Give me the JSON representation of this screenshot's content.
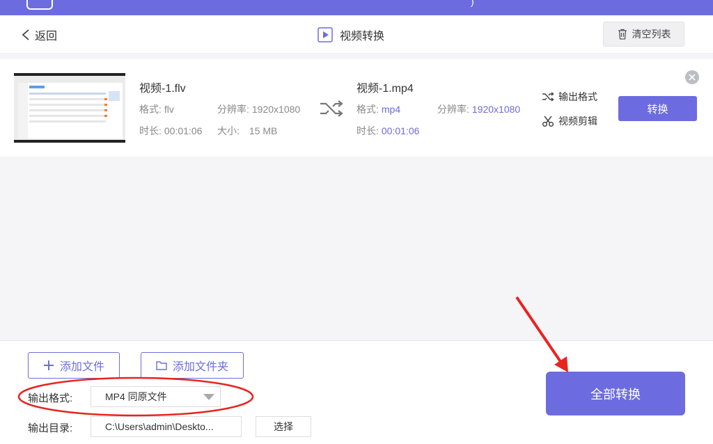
{
  "header": {
    "back_label": "返回",
    "title": "视频转换",
    "clear_label": "清空列表"
  },
  "file": {
    "source": {
      "name": "视频-1.flv",
      "format_label": "格式:",
      "format": "flv",
      "resolution_label": "分辨率:",
      "resolution": "1920x1080",
      "duration_label": "时长:",
      "duration": "00:01:06",
      "size_label": "大小:",
      "size": "15 MB"
    },
    "target": {
      "name": "视频-1.mp4",
      "format_label": "格式:",
      "format": "mp4",
      "resolution_label": "分辨率:",
      "resolution": "1920x1080",
      "duration_label": "时长:",
      "duration": "00:01:06"
    },
    "output_format_label": "输出格式",
    "video_edit_label": "视频剪辑",
    "convert_label": "转换"
  },
  "bottom": {
    "add_file_label": "添加文件",
    "add_folder_label": "添加文件夹",
    "output_format_label": "输出格式:",
    "output_format_value": "MP4 同原文件",
    "output_dir_label": "输出目录:",
    "output_dir_value": "C:\\Users\\admin\\Deskto...",
    "choose_label": "选择",
    "convert_all_label": "全部转换"
  },
  "colors": {
    "accent": "#6c6ce0",
    "annotation": "#e8241f"
  }
}
